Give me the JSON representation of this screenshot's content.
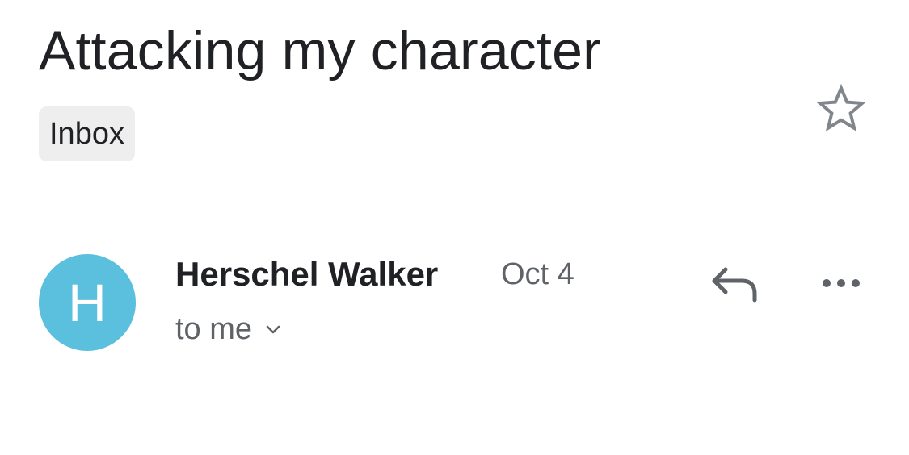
{
  "email": {
    "subject": "Attacking my character",
    "label": "Inbox",
    "starred": false
  },
  "message": {
    "avatar_letter": "H",
    "avatar_color": "#5bbfde",
    "sender_name": "Herschel Walker",
    "date": "Oct 4",
    "recipient": "to me"
  },
  "icons": {
    "star": "star-outline-icon",
    "reply": "reply-icon",
    "more": "more-horizontal-icon",
    "expand": "chevron-down-icon"
  },
  "colors": {
    "text_primary": "#202124",
    "text_secondary": "#5f6368",
    "chip_background": "#eeeeee",
    "icon_gray": "#80868b"
  }
}
